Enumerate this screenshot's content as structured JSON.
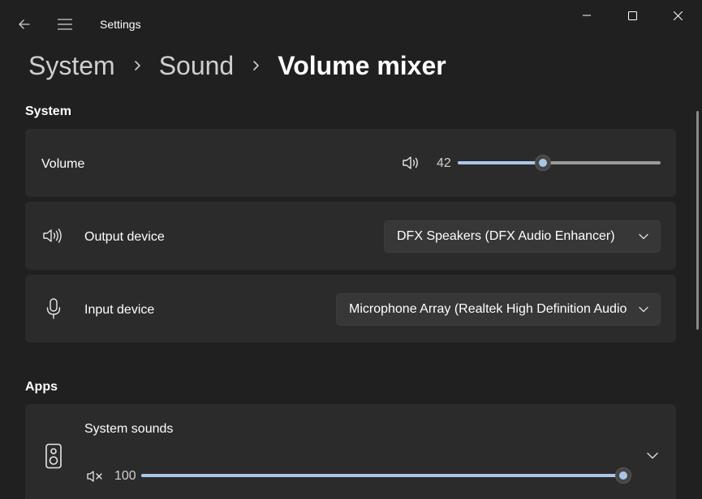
{
  "window": {
    "title": "Settings"
  },
  "breadcrumb": {
    "items": [
      "System",
      "Sound"
    ],
    "current": "Volume mixer"
  },
  "system_section": {
    "title": "System",
    "volume": {
      "label": "Volume",
      "value": "42",
      "level": 42,
      "icon": "speaker-icon"
    },
    "output_device": {
      "label": "Output device",
      "selected": "DFX Speakers (DFX Audio Enhancer)",
      "icon": "speaker-icon"
    },
    "input_device": {
      "label": "Input device",
      "selected": "Microphone Array (Realtek High Definition Audio)",
      "icon": "microphone-icon"
    }
  },
  "apps_section": {
    "title": "Apps",
    "apps": [
      {
        "name": "System sounds",
        "volume": "100",
        "level": 100,
        "icon": "speaker-device-icon",
        "mute_icon": "speaker-mute-icon"
      }
    ]
  },
  "colors": {
    "background": "#202020",
    "card": "#2b2b2b",
    "accent": "#a8c7e8",
    "dropdown": "#373737"
  }
}
